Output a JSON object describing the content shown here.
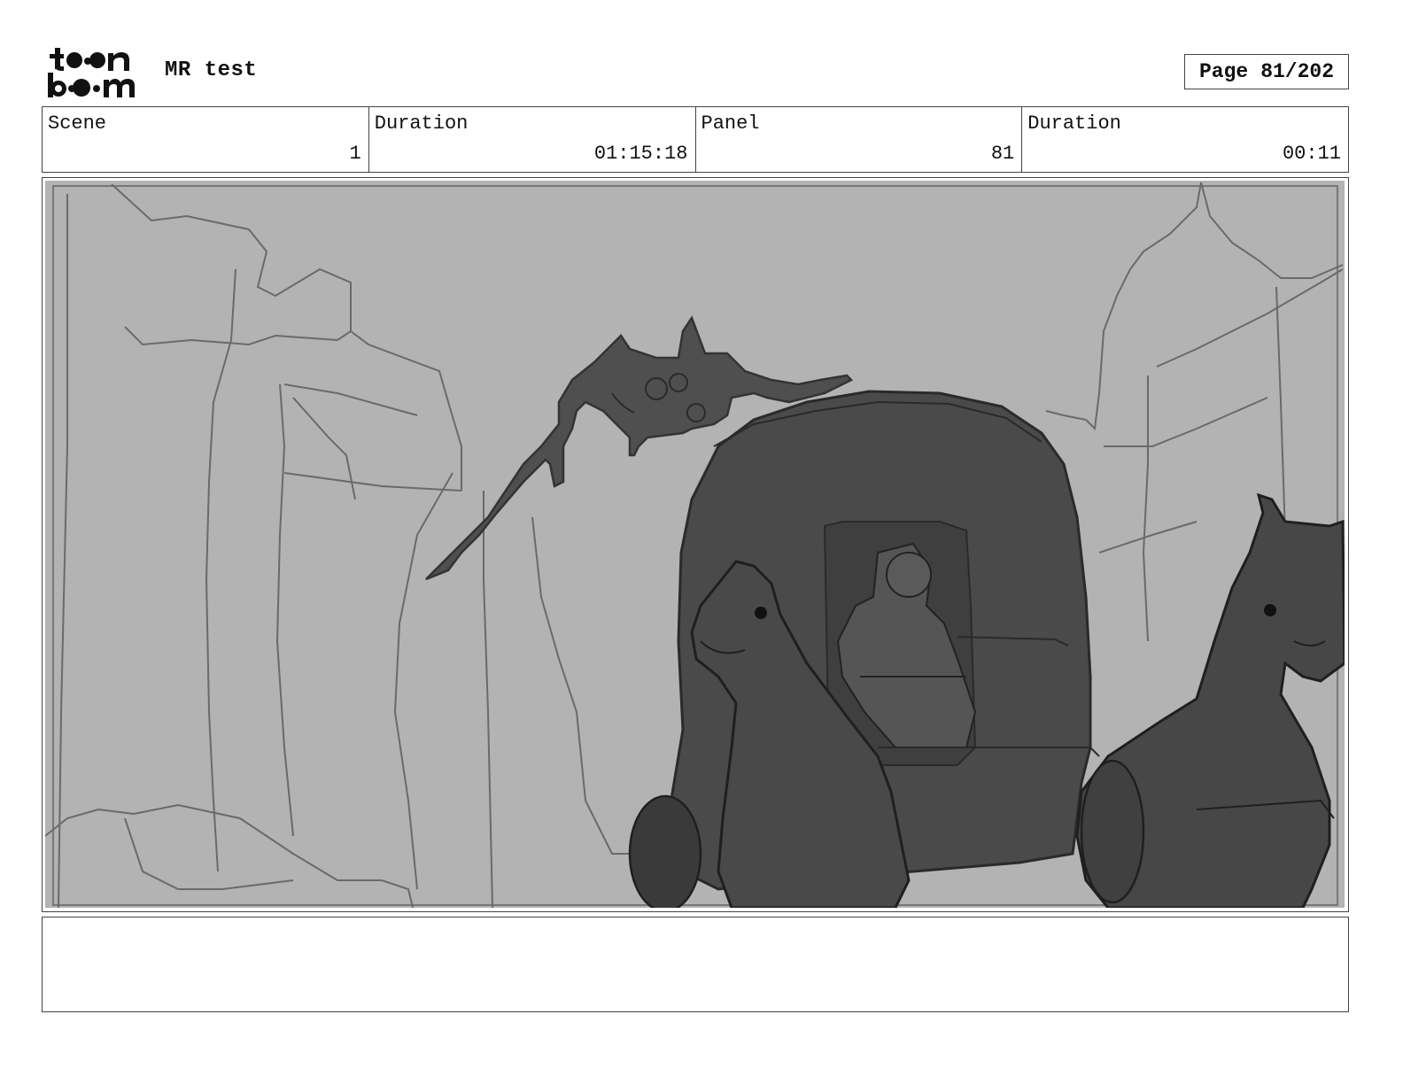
{
  "header": {
    "logo_icon": "toon-boom-logo",
    "project_title": "MR test",
    "page_label": "Page",
    "page_value": "81/202"
  },
  "info": {
    "scene_label": "Scene",
    "scene_value": "1",
    "scene_duration_label": "Duration",
    "scene_duration_value": "01:15:18",
    "panel_label": "Panel",
    "panel_value": "81",
    "panel_duration_label": "Duration",
    "panel_duration_value": "00:11"
  },
  "panel": {
    "image_icon": "storyboard-sketch-bat-creature-over-horse-drawn-carriage",
    "background_color": "#b3b3b3",
    "shadow_color": "#4a4a4a"
  },
  "notes": {
    "text": ""
  }
}
